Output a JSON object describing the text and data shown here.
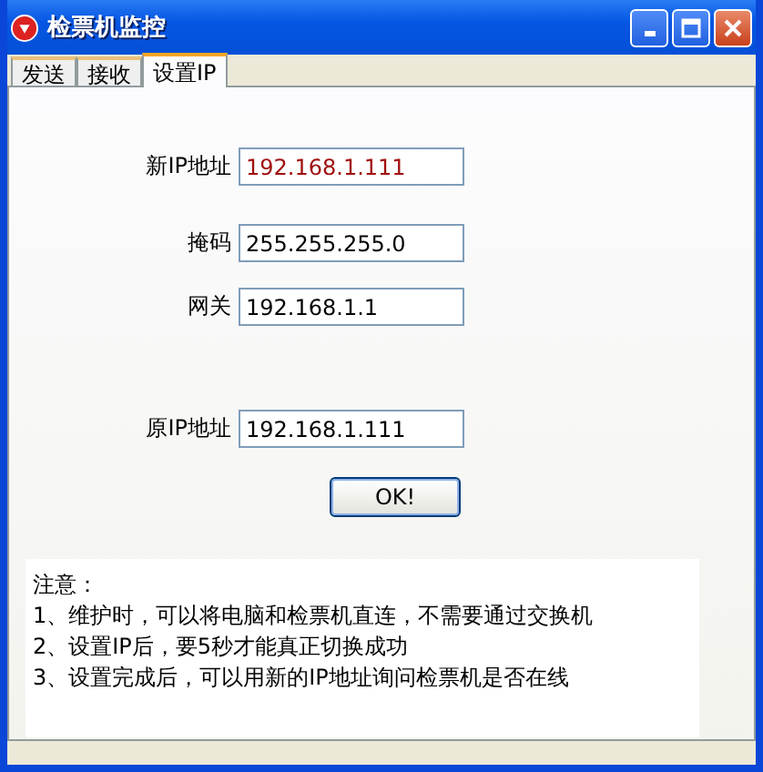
{
  "window": {
    "title": "检票机监控"
  },
  "tabs": [
    {
      "label": "发送",
      "selected": false
    },
    {
      "label": "接收",
      "selected": false
    },
    {
      "label": "设置IP",
      "selected": true
    }
  ],
  "fields": [
    {
      "label": "新IP地址",
      "value": "192.168.1.111",
      "color": "#a01010"
    },
    {
      "label": "掩码",
      "value": "255.255.255.0",
      "color": "#000000"
    },
    {
      "label": "网关",
      "value": "192.168.1.1",
      "color": "#000000"
    },
    {
      "label": "原IP地址",
      "value": "192.168.1.111",
      "color": "#000000"
    }
  ],
  "ok_button": "OK!",
  "notes": [
    "注意：",
    "1、维护时，可以将电脑和检票机直连，不需要通过交换机",
    "2、设置IP后，要5秒才能真正切换成功",
    "3、设置完成后，可以用新的IP地址询问检票机是否在线"
  ]
}
